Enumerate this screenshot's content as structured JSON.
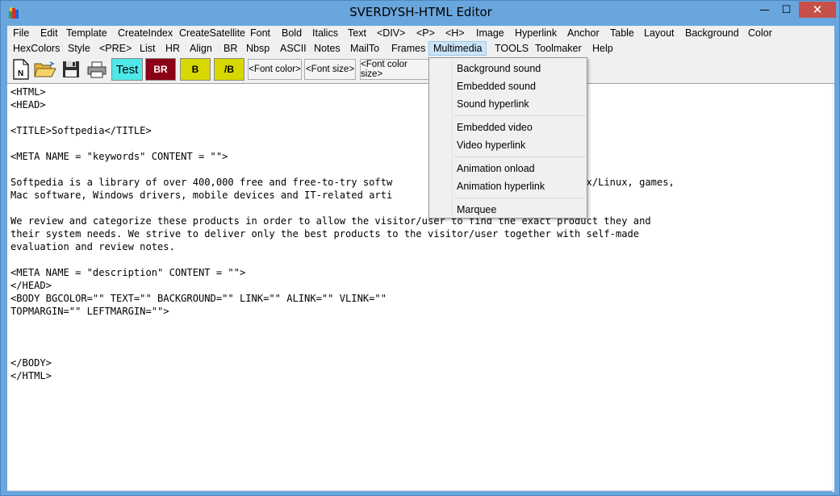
{
  "window": {
    "title": "SVERDYSH-HTML Editor",
    "min_symbol": "—",
    "max_symbol": "☐",
    "close_symbol": "✕"
  },
  "menu_row1": [
    "File",
    "Edit",
    "Template",
    "CreateIndex",
    "CreateSatellite",
    "Font",
    "Bold",
    "Italics",
    "Text",
    "<DIV>",
    "<P>",
    "<H>",
    "Image",
    "Hyperlink",
    "Anchor",
    "Table",
    "Layout",
    "Background",
    "Color"
  ],
  "menu_row2": [
    "HexColors",
    "Style",
    "<PRE>",
    "List",
    "HR",
    "Align",
    "BR",
    "Nbsp",
    "ASCII",
    "Notes",
    "MailTo",
    "Frames",
    "Multimedia",
    "TOOLS",
    "Toolmaker",
    "Help"
  ],
  "toolbar": {
    "new_icon_label": "N",
    "test_label": "Test",
    "br_label": "BR",
    "bold_label": "B",
    "close_bold_label": "/B",
    "font_color_label": "<Font color>",
    "font_size_label": "<Font size>",
    "font_color_size_label": "<Font color size>",
    "colors": {
      "test_bg": "#4fe8e8",
      "br_bg": "#8b0016",
      "b_bg": "#d8d800",
      "accent": "#cce4f7"
    }
  },
  "multimedia_menu": {
    "groups": [
      [
        "Background sound",
        "Embedded sound",
        "Sound hyperlink"
      ],
      [
        "Embedded video",
        "Video hyperlink"
      ],
      [
        "Animation onload",
        "Animation hyperlink"
      ],
      [
        "Marquee"
      ]
    ]
  },
  "editor": {
    "content": "<HTML>\n<HEAD>\n\n<TITLE>Softpedia</TITLE>\n\n<META NAME = \"keywords\" CONTENT = \"\">\n\nSoftpedia is a library of over 400,000 free and free-to-try softw                          and Unix/Linux, games,\nMac software, Windows drivers, mobile devices and IT-related arti\n\nWe review and categorize these products in order to allow the visitor/user to find the exact product they and\ntheir system needs. We strive to deliver only the best products to the visitor/user together with self-made\nevaluation and review notes.\n\n<META NAME = \"description\" CONTENT = \"\">\n</HEAD>\n<BODY BGCOLOR=\"\" TEXT=\"\" BACKGROUND=\"\" LINK=\"\" ALINK=\"\" VLINK=\"\"\nTOPMARGIN=\"\" LEFTMARGIN=\"\">\n\n\n\n</BODY>\n</HTML>"
  }
}
